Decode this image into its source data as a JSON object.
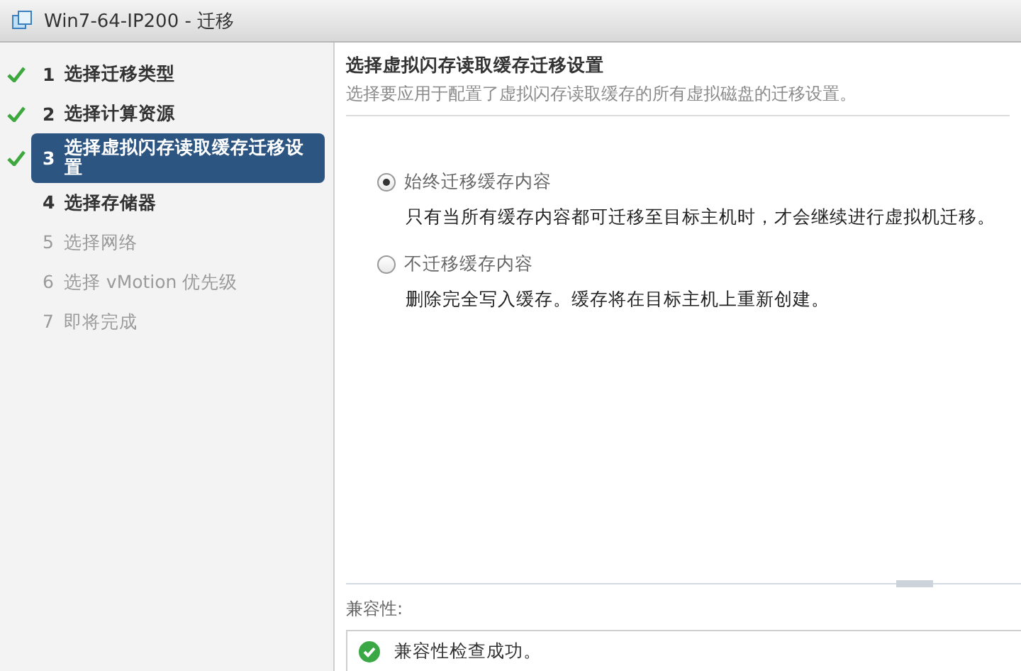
{
  "window": {
    "title": "Win7-64-IP200 - 迁移"
  },
  "steps": [
    {
      "number": "1",
      "label": "选择迁移类型",
      "done": true,
      "selected": false,
      "disabled": false
    },
    {
      "number": "2",
      "label": "选择计算资源",
      "done": true,
      "selected": false,
      "disabled": false
    },
    {
      "number": "3",
      "label": "选择虚拟闪存读取缓存迁移设置",
      "done": true,
      "selected": true,
      "disabled": false
    },
    {
      "number": "4",
      "label": "选择存储器",
      "done": false,
      "selected": false,
      "disabled": false
    },
    {
      "number": "5",
      "label": "选择网络",
      "done": false,
      "selected": false,
      "disabled": true
    },
    {
      "number": "6",
      "label": "选择 vMotion 优先级",
      "done": false,
      "selected": false,
      "disabled": true
    },
    {
      "number": "7",
      "label": "即将完成",
      "done": false,
      "selected": false,
      "disabled": true
    }
  ],
  "page": {
    "title": "选择虚拟闪存读取缓存迁移设置",
    "subtitle": "选择要应用于配置了虚拟闪存读取缓存的所有虚拟磁盘的迁移设置。"
  },
  "options": [
    {
      "label": "始终迁移缓存内容",
      "description": "只有当所有缓存内容都可迁移至目标主机时，才会继续进行虚拟机迁移。",
      "selected": true
    },
    {
      "label": "不迁移缓存内容",
      "description": "删除完全写入缓存。缓存将在目标主机上重新创建。",
      "selected": false
    }
  ],
  "compatibility": {
    "label": "兼容性:",
    "result": "兼容性检查成功。",
    "passed": true
  }
}
